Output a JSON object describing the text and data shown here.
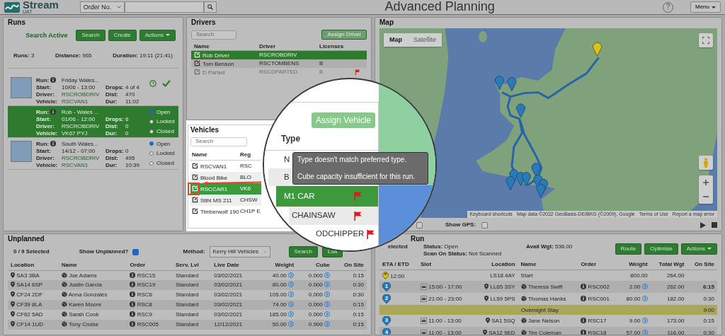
{
  "header": {
    "logo": "Stream",
    "env": "UAT",
    "search_type": "Order No.",
    "title": "Advanced Planning",
    "help": "?",
    "menu": "Menu"
  },
  "runs": {
    "title": "Runs",
    "search_status": "Search Active",
    "buttons": [
      {
        "label": "Search"
      },
      {
        "label": "Create"
      },
      {
        "label": "Actions",
        "dropdown": true
      }
    ],
    "summary": [
      {
        "label": "Runs:",
        "value": "3"
      },
      {
        "label": "Distance:",
        "value": "965"
      },
      {
        "label": "Duration:",
        "value": "19:11 (21:41)"
      }
    ],
    "items": [
      {
        "selected": false,
        "map_thumbnail": true,
        "scheduled": true,
        "complete": true,
        "left": [
          {
            "label": "Run:",
            "value": "Friday Wales...",
            "info": true
          },
          {
            "label": "Start:",
            "value": "10/06 - 13:00"
          },
          {
            "label": "Driver:",
            "value": "RSCROBDRIV",
            "link": true
          },
          {
            "label": "Vehicle:",
            "value": "RSCVAN1",
            "link": true
          }
        ],
        "right": [
          {
            "label": "Drops:",
            "value": "4 of 4"
          },
          {
            "label": "Dist:",
            "value": "470"
          },
          {
            "label": "Dur:",
            "value": "11:02"
          }
        ]
      },
      {
        "selected": true,
        "left": [
          {
            "label": "Run:",
            "value": "Rob - Wales ...",
            "info": true
          },
          {
            "label": "Start:",
            "value": "01/06 - 12:00"
          },
          {
            "label": "Driver:",
            "value": "RSCROBDRIV",
            "link": true
          },
          {
            "label": "Vehicle:",
            "value": "VK67 PYJ",
            "link": true
          }
        ],
        "right": [
          {
            "label": "Drops:",
            "value": "6"
          },
          {
            "label": "Dist:",
            "value": "0"
          },
          {
            "label": "Dur:",
            "value": "0"
          }
        ],
        "statuses": [
          {
            "label": "Open",
            "selected": true
          },
          {
            "label": "Locked",
            "selected": false
          },
          {
            "label": "Closed",
            "selected": false
          }
        ]
      },
      {
        "selected": false,
        "map_thumbnail": true,
        "left": [
          {
            "label": "Run:",
            "value": "South Wales...",
            "info": true
          },
          {
            "label": "Start:",
            "value": "14/12 - 07:00"
          },
          {
            "label": "Driver:",
            "value": "RSCROBDRIV",
            "link": true
          },
          {
            "label": "Vehicle:",
            "value": "RSCVAN1",
            "link": true
          }
        ],
        "right": [
          {
            "label": "Drops:",
            "value": "0"
          },
          {
            "label": "Dist:",
            "value": "495"
          },
          {
            "label": "Dur:",
            "value": "10:39"
          }
        ],
        "statuses": [
          {
            "label": "Open",
            "selected": true
          },
          {
            "label": "Locked",
            "selected": false
          },
          {
            "label": "Closed",
            "selected": false
          }
        ]
      }
    ]
  },
  "drivers": {
    "title": "Drivers",
    "search_placeholder": "Search",
    "assign_button": {
      "label": "Assign Driver",
      "disabled": true
    },
    "columns": [
      "Name",
      "Driver",
      "Licenses"
    ],
    "rows": [
      {
        "name": "Rob Driver",
        "driver": "RSCROBDRIV",
        "selected": true,
        "disabled": false
      },
      {
        "name": "Tom Benson",
        "driver": "RSCTOMBENS",
        "licenses": "B",
        "selected": false,
        "disabled": false
      },
      {
        "name": "D Parted",
        "driver": "RSCDPARTED",
        "licenses": "B",
        "selected": false,
        "disabled": true,
        "flagged": true
      }
    ]
  },
  "vehicles": {
    "title": "Vehicles",
    "search_placeholder": "Search",
    "columns": [
      "Name",
      "Reg"
    ],
    "rows": [
      {
        "name": "RSCVAN1",
        "reg": "RSC",
        "selected": false
      },
      {
        "name": "Blood Bike",
        "reg": "BLO",
        "selected": false
      },
      {
        "name": "RSCCAR1",
        "reg": "VK6",
        "selected": true
      },
      {
        "name": "Stihl MS 211",
        "reg": "CHSW",
        "selected": false
      },
      {
        "name": "Timberwolf 190",
        "reg": "CH1P E",
        "selected": false
      }
    ]
  },
  "magnifier": {
    "assign_button": "Assign Vehicle",
    "type_header": "Type",
    "rows": [
      {
        "type": "N",
        "selected": false
      },
      {
        "type": "B",
        "selected": false
      },
      {
        "type": "M1 CAR",
        "selected": true,
        "flagged": true
      },
      {
        "type": "CHAINSAW",
        "selected": false,
        "flagged": true
      },
      {
        "type": "ODCHIPPER",
        "selected": false,
        "flagged": true
      }
    ],
    "tooltip": [
      "Type doesn't match preferred type.",
      "Cube capacity insufficient for this run."
    ]
  },
  "map": {
    "title": "Map",
    "map_types": [
      {
        "label": "Map",
        "selected": true
      },
      {
        "label": "Satellite",
        "selected": false
      }
    ],
    "attribution": [
      "Keyboard shortcuts",
      "Map data ©2022 GeoBasis-DE/BKG (©2009), Google",
      "Terms of Use",
      "Report a map error"
    ],
    "extra_toggle": {
      "checked": false
    },
    "show_gps": {
      "label": "Show GPS:",
      "checked": false
    }
  },
  "unplanned": {
    "title": "Unplanned",
    "selected_count": "0 / 9 Selected",
    "show_unplanned": {
      "label": "Show Unplanned?",
      "checked": true
    },
    "method": {
      "label": "Method:",
      "value": "Kerry Hill Vehicles"
    },
    "buttons": [
      "Search",
      "Loa"
    ],
    "columns": [
      "Location",
      "Name",
      "Order",
      "Serv. Lvl",
      "Live Date",
      "Weight",
      "Cube",
      "On Site"
    ],
    "rows": [
      {
        "location": "SA3 3BA",
        "name": "Joe Adams",
        "order": "RSC15",
        "service": "Standard",
        "live_date": "03/02/2021",
        "weight": "40.00",
        "cube": "0.000",
        "on_site": "0:15"
      },
      {
        "location": "SA14 6SP",
        "name": "Justin Garcia",
        "order": "RSC19",
        "service": "Standard",
        "live_date": "03/02/2021",
        "weight": "80.00",
        "cube": "0.000",
        "on_site": "0:30"
      },
      {
        "location": "CF24 2DF",
        "name": "Anna Gonzales",
        "order": "RSC6",
        "service": "Standard",
        "live_date": "03/02/2021",
        "weight": "105.00",
        "cube": "0.000",
        "on_site": "0:30"
      },
      {
        "location": "CF39 8LA",
        "name": "Karen Moore",
        "order": "RSC8",
        "service": "Standard",
        "live_date": "03/02/2021",
        "weight": "74.00",
        "cube": "0.000",
        "on_site": "0:15"
      },
      {
        "location": "CF62 5AD",
        "name": "Sarah Cook",
        "order": "RSC9",
        "service": "Standard",
        "live_date": "03/02/2021",
        "weight": "185.00",
        "cube": "0.000",
        "on_site": "0:15"
      },
      {
        "location": "CF14 1UD",
        "name": "Tony Cruise",
        "order": "RSC005",
        "service": "Standard",
        "live_date": "12/12/2021",
        "weight": "50.00",
        "cube": "0.900",
        "on_site": "0:15"
      }
    ]
  },
  "current_run": {
    "title": "Run",
    "selected_count": "elected",
    "status": {
      "label": "Status:",
      "value": "Open"
    },
    "scan_status": {
      "label": "Scan On Status:",
      "value": "Not Scanned"
    },
    "avail_wgt": {
      "label": "Avail Wgt:",
      "value": "536.00"
    },
    "buttons": [
      {
        "label": "Route"
      },
      {
        "label": "Optimise"
      },
      {
        "label": "Actions",
        "dropdown": true
      }
    ],
    "columns": [
      "ETA / ETD",
      "Slot",
      "Location",
      "Name",
      "Order",
      "Weight",
      "Total Wgt",
      "On Site"
    ],
    "rows": [
      {
        "kind": "start",
        "eta": "12:00",
        "location": "LS18 4AY",
        "name": "Start",
        "weight": "800.00",
        "total": "264.00"
      },
      {
        "kind": "stop",
        "marker": "1",
        "slot": "15:00 - 17:00",
        "location": "LL65 3SY",
        "name": "Theresa Swift",
        "order": "RSC002",
        "weight": "2.00",
        "total": "262.00",
        "on_site": "6:15",
        "late": true
      },
      {
        "kind": "stop",
        "marker": "2",
        "slot": "21:00 - 23:00",
        "location": "LL59 5PS",
        "name": "Thomas Hanks",
        "order": "RSC001",
        "weight": "80.00",
        "total": "182.00",
        "on_site": "0:30",
        "late": false
      },
      {
        "kind": "overnight",
        "name": "Overnight Stay",
        "on_site": "9:00"
      },
      {
        "kind": "stop",
        "marker": "3",
        "slot": "11:00 - 13:00",
        "location": "SA1 5SQ",
        "name": "Jane Nelson",
        "order": "RSC17",
        "weight": "9.00",
        "total": "173.00",
        "on_site": "0:15",
        "late": false
      },
      {
        "kind": "stop",
        "marker": "4",
        "slot": "11:00 - 13:00",
        "location": "SA12 9ED",
        "name": "Tim Coleman",
        "order": "RSC18",
        "weight": "57.00",
        "total": "116.00",
        "on_site": "0:30",
        "late": false
      }
    ]
  }
}
